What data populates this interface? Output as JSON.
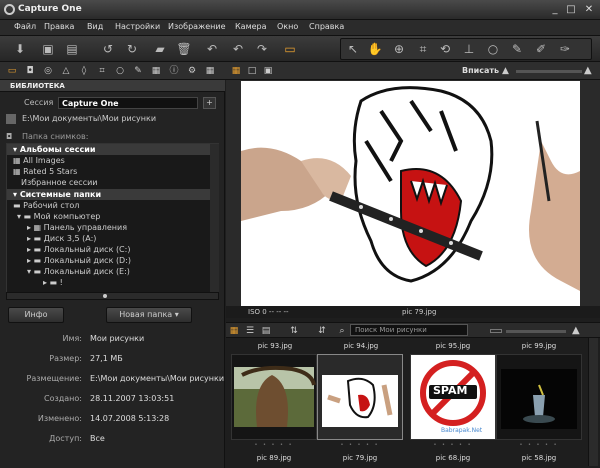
{
  "window": {
    "title": "Capture One",
    "min": "_",
    "max": "□",
    "close": "✕"
  },
  "menu": [
    "Файл",
    "Правка",
    "Вид",
    "Настройки",
    "Изображение",
    "Камера",
    "Окно",
    "Справка"
  ],
  "tabs_right": {
    "fit_label": "Вписать"
  },
  "library": {
    "section_title": "БИБЛИОТЕКА",
    "session_label": "Сессия",
    "session_value": "Capture One",
    "path": "E:\\Мои документы\\Мои рисунки",
    "folder_header": "Папка снимков:",
    "tree": [
      {
        "label": "Альбомы сессии",
        "header": true
      },
      {
        "label": "All Images"
      },
      {
        "label": "Rated 5 Stars"
      },
      {
        "label": "Избранное сессии"
      },
      {
        "label": "Системные папки",
        "header": true
      },
      {
        "label": "Рабочий стол"
      },
      {
        "label": "Мой компьютер"
      },
      {
        "label": "Панель управления"
      },
      {
        "label": "Диск 3,5 (A:)"
      },
      {
        "label": "Локальный диск (C:)"
      },
      {
        "label": "Локальный диск (D:)"
      },
      {
        "label": "Локальный диск (E:)"
      },
      {
        "label": "!"
      }
    ],
    "info_button": "Инфо",
    "new_folder_button": "Новая папка"
  },
  "info": [
    {
      "label": "Имя:",
      "value": "Мои рисунки"
    },
    {
      "label": "Размер:",
      "value": "27,1 МБ"
    },
    {
      "label": "Размещение:",
      "value": "E:\\Мои документы\\Мои рисунки"
    },
    {
      "label": "Создано:",
      "value": "28.11.2007 13:03:51"
    },
    {
      "label": "Изменено:",
      "value": "14.07.2008 5:13:28"
    },
    {
      "label": "Доступ:",
      "value": "Все"
    }
  ],
  "viewer": {
    "iso": "ISO 0 -- -- --",
    "filename": "pic 79.jpg"
  },
  "browser": {
    "search_placeholder": "Поиск Мои рисунки",
    "top_labels": [
      "pic 93.jpg",
      "pic 94.jpg",
      "pic 95.jpg",
      "pic 99.jpg"
    ],
    "thumbs": [
      "pic 89.jpg",
      "pic 79.jpg",
      "pic 68.jpg",
      "pic 58.jpg"
    ],
    "spam_text": "SPAM",
    "watermark": "Babrapak.Net"
  }
}
